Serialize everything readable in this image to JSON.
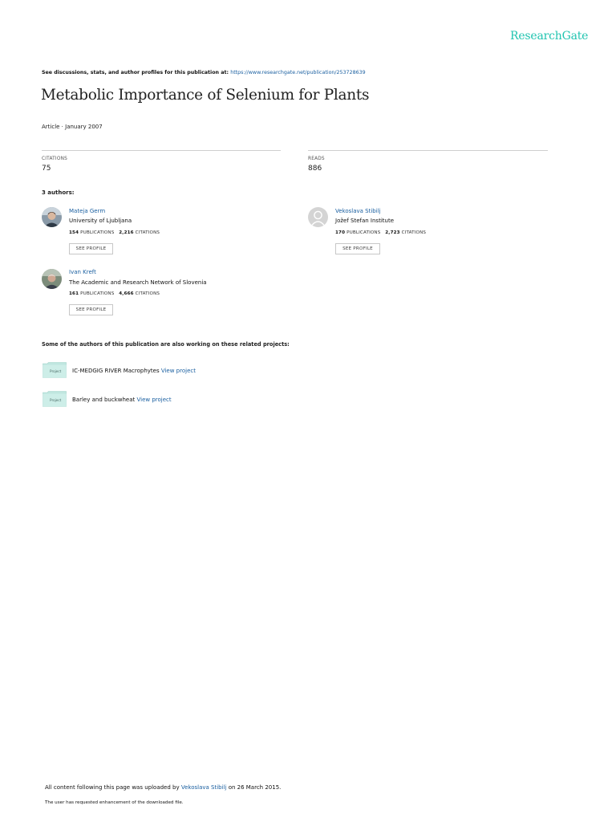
{
  "logo": "ResearchGate",
  "see_line": {
    "prefix": "See discussions, stats, and author profiles for this publication at:",
    "url": "https://www.researchgate.net/publication/253728639"
  },
  "title": "Metabolic Importance of Selenium for Plants",
  "article_meta": "Article · January 2007",
  "stats": {
    "citations_label": "CITATIONS",
    "citations_value": "75",
    "reads_label": "READS",
    "reads_value": "886"
  },
  "authors_heading": "3 authors:",
  "authors": [
    {
      "name": "Mateja Germ",
      "institution": "University of Ljubljana",
      "publications": "154",
      "publications_label": "PUBLICATIONS",
      "citations": "2,216",
      "citations_label": "CITATIONS",
      "button": "SEE PROFILE"
    },
    {
      "name": "Vekoslava Stibilj",
      "institution": "Jožef Stefan Institute",
      "publications": "170",
      "publications_label": "PUBLICATIONS",
      "citations": "2,723",
      "citations_label": "CITATIONS",
      "button": "SEE PROFILE"
    },
    {
      "name": "Ivan Kreft",
      "institution": "The Academic and Research Network of Slovenia",
      "publications": "161",
      "publications_label": "PUBLICATIONS",
      "citations": "4,666",
      "citations_label": "CITATIONS",
      "button": "SEE PROFILE"
    }
  ],
  "related_heading": "Some of the authors of this publication are also working on these related projects:",
  "projects": [
    {
      "icon_label": "Project",
      "name": "IC-MEDGIG RIVER Macrophytes",
      "link": "View project"
    },
    {
      "icon_label": "Project",
      "name": "Barley and buckwheat",
      "link": "View project"
    }
  ],
  "footer": {
    "prefix": "All content following this page was uploaded by",
    "uploader": "Vekoslava Stibilj",
    "suffix": "on 26 March 2015.",
    "note": "The user has requested enhancement of the downloaded file."
  },
  "colors": {
    "brand": "#20c4b0",
    "link": "#1a5fa0",
    "project_icon": "#bfe6df"
  }
}
